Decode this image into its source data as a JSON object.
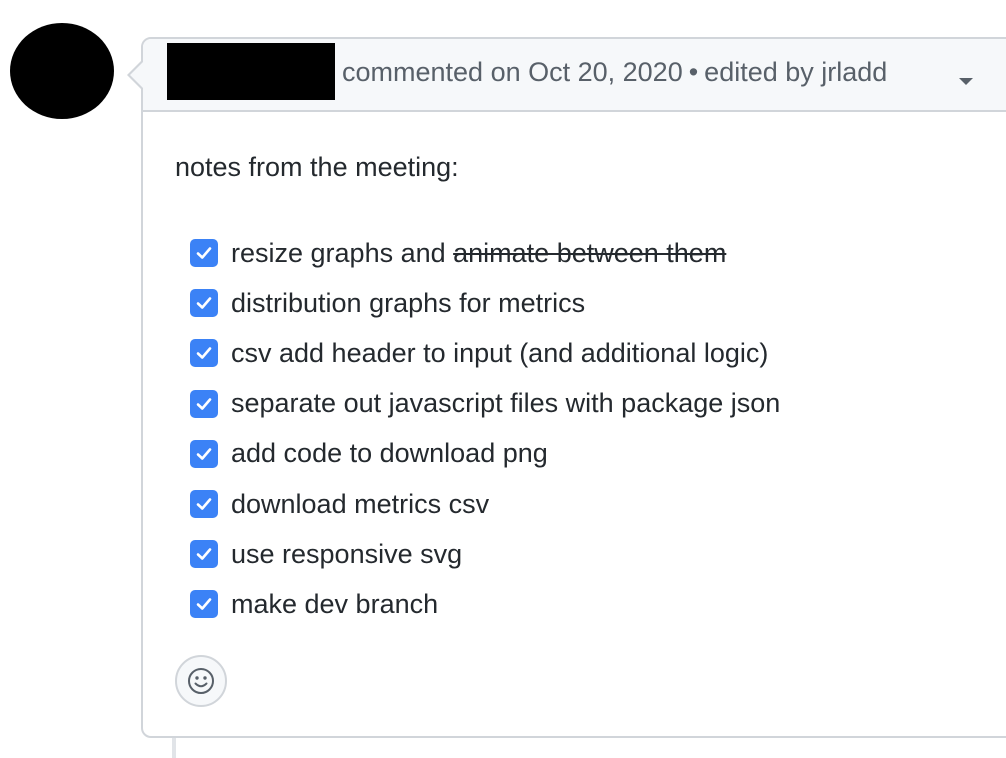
{
  "comment": {
    "author": "",
    "action_text": "commented on Oct 20, 2020",
    "separator": "•",
    "edited_text": "edited by jrladd",
    "intro": "notes from the meeting:",
    "tasks": [
      {
        "text": "resize graphs and ",
        "struck_text": "animate between them",
        "checked": true
      },
      {
        "text": "distribution graphs for metrics",
        "checked": true
      },
      {
        "text": "csv add header to input (and additional logic)",
        "checked": true
      },
      {
        "text": "separate out javascript files with package json",
        "checked": true
      },
      {
        "text": "add code to download png",
        "checked": true
      },
      {
        "text": "download metrics csv",
        "checked": true
      },
      {
        "text": "use responsive svg",
        "checked": true
      },
      {
        "text": "make dev branch",
        "checked": true
      }
    ]
  },
  "icons": {
    "checkbox": "check-icon",
    "reaction": "smiley-icon",
    "header_menu": "chevron-down-icon"
  },
  "colors": {
    "checkbox": "#3b82f6",
    "header_bg": "#f6f8fa",
    "border": "#d1d5da",
    "muted_text": "#586069"
  }
}
